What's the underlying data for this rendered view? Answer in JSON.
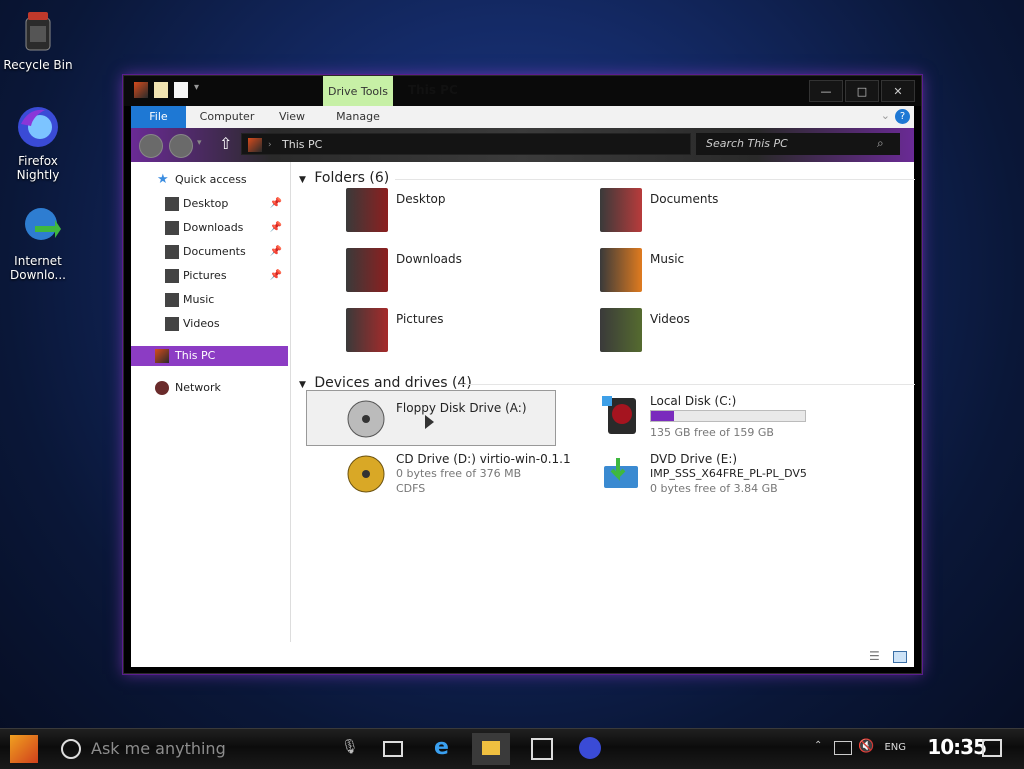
{
  "desktop": {
    "icons": [
      {
        "label": "Recycle Bin"
      },
      {
        "label": "Firefox Nightly"
      },
      {
        "label": "Internet Downlo..."
      }
    ]
  },
  "window": {
    "title": "This PC",
    "contextual_tab": "Drive Tools",
    "buttons": {
      "minimize": "—",
      "maximize": "□",
      "close": "✕"
    },
    "ribbon_tabs": [
      "File",
      "Computer",
      "View",
      "Manage"
    ],
    "address": {
      "path": "This PC"
    },
    "search": {
      "placeholder": "Search This PC"
    },
    "nav": {
      "quick_access": "Quick access",
      "items": [
        {
          "label": "Desktop",
          "pinned": true
        },
        {
          "label": "Downloads",
          "pinned": true
        },
        {
          "label": "Documents",
          "pinned": true
        },
        {
          "label": "Pictures",
          "pinned": true
        },
        {
          "label": "Music",
          "pinned": false
        },
        {
          "label": "Videos",
          "pinned": false
        }
      ],
      "this_pc": "This PC",
      "network": "Network"
    },
    "folders": {
      "heading": "Folders (6)",
      "items": [
        "Desktop",
        "Documents",
        "Downloads",
        "Music",
        "Pictures",
        "Videos"
      ]
    },
    "devices": {
      "heading": "Devices and drives (4)",
      "floppy": {
        "name": "Floppy Disk Drive (A:)"
      },
      "local": {
        "name": "Local Disk (C:)",
        "free": "135 GB free of 159 GB",
        "used_fraction": 0.15
      },
      "cd": {
        "name": "CD Drive (D:) virtio-win-0.1.1",
        "free": "0 bytes free of 376 MB",
        "fs": "CDFS"
      },
      "dvd": {
        "name": "DVD Drive (E:)",
        "label": "IMP_SSS_X64FRE_PL-PL_DV5",
        "free": "0 bytes free of 3.84 GB"
      }
    }
  },
  "taskbar": {
    "search_placeholder": "Ask me anything",
    "lang": "ENG",
    "clock": "10:35"
  },
  "colors": {
    "accent": "#8c3cc4",
    "file_tab": "#1e78d4",
    "drive_tools": "#c7f0a6"
  }
}
